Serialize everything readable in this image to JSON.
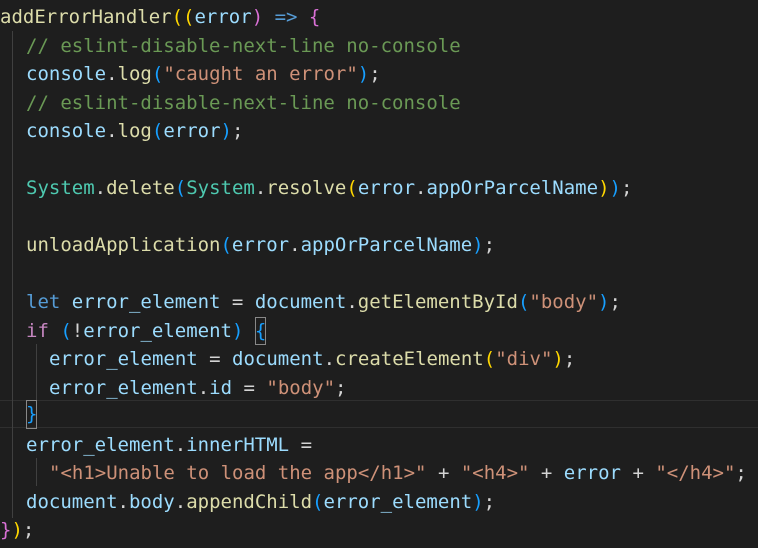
{
  "code": {
    "l1": {
      "fn": "addErrorHandler",
      "paren_open": "((",
      "param": "error",
      "paren_close": ") ",
      "arrow": "=>",
      "brace": " {"
    },
    "l2": {
      "comment": "// eslint-disable-next-line no-console"
    },
    "l3": {
      "obj": "console",
      "dot": ".",
      "fn": "log",
      "open": "(",
      "str": "\"caught an error\"",
      "close": ")",
      "semi": ";"
    },
    "l4": {
      "comment": "// eslint-disable-next-line no-console"
    },
    "l5": {
      "obj": "console",
      "dot": ".",
      "fn": "log",
      "open": "(",
      "arg": "error",
      "close": ")",
      "semi": ";"
    },
    "l7": {
      "cls1": "System",
      "dot1": ".",
      "fn1": "delete",
      "open1": "(",
      "cls2": "System",
      "dot2": ".",
      "fn2": "resolve",
      "open2": "(",
      "obj": "error",
      "dot3": ".",
      "prop": "appOrParcelName",
      "close2": ")",
      "close1": ")",
      "semi": ";"
    },
    "l9": {
      "fn": "unloadApplication",
      "open": "(",
      "obj": "error",
      "dot": ".",
      "prop": "appOrParcelName",
      "close": ")",
      "semi": ";"
    },
    "l11": {
      "kw": "let",
      "var": " error_element",
      "eq": " = ",
      "obj": "document",
      "dot": ".",
      "fn": "getElementById",
      "open": "(",
      "str": "\"body\"",
      "close": ")",
      "semi": ";"
    },
    "l12": {
      "kw": "if",
      "sp": " ",
      "open": "(",
      "not": "!",
      "var": "error_element",
      "close": ")",
      "sp2": " ",
      "brace": "{"
    },
    "l13": {
      "var": "error_element",
      "eq": " = ",
      "obj": "document",
      "dot": ".",
      "fn": "createElement",
      "open": "(",
      "str": "\"div\"",
      "close": ")",
      "semi": ";"
    },
    "l14": {
      "var": "error_element",
      "dot": ".",
      "prop": "id",
      "eq": " = ",
      "str": "\"body\"",
      "semi": ";"
    },
    "l15": {
      "brace": "}"
    },
    "l16": {
      "var": "error_element",
      "dot": ".",
      "prop": "innerHTML",
      "eq": " ="
    },
    "l17": {
      "str1": "\"<h1>Unable to load the app</h1>\"",
      "plus1": " + ",
      "str2": "\"<h4>\"",
      "plus2": " + ",
      "var": "error",
      "plus3": " + ",
      "str3": "\"</h4>\"",
      "semi": ";"
    },
    "l18": {
      "obj": "document",
      "dot1": ".",
      "prop": "body",
      "dot2": ".",
      "fn": "appendChild",
      "open": "(",
      "arg": "error_element",
      "close": ")",
      "semi": ";"
    },
    "l19": {
      "brace": "}",
      "paren": ")",
      "semi": ";"
    }
  }
}
